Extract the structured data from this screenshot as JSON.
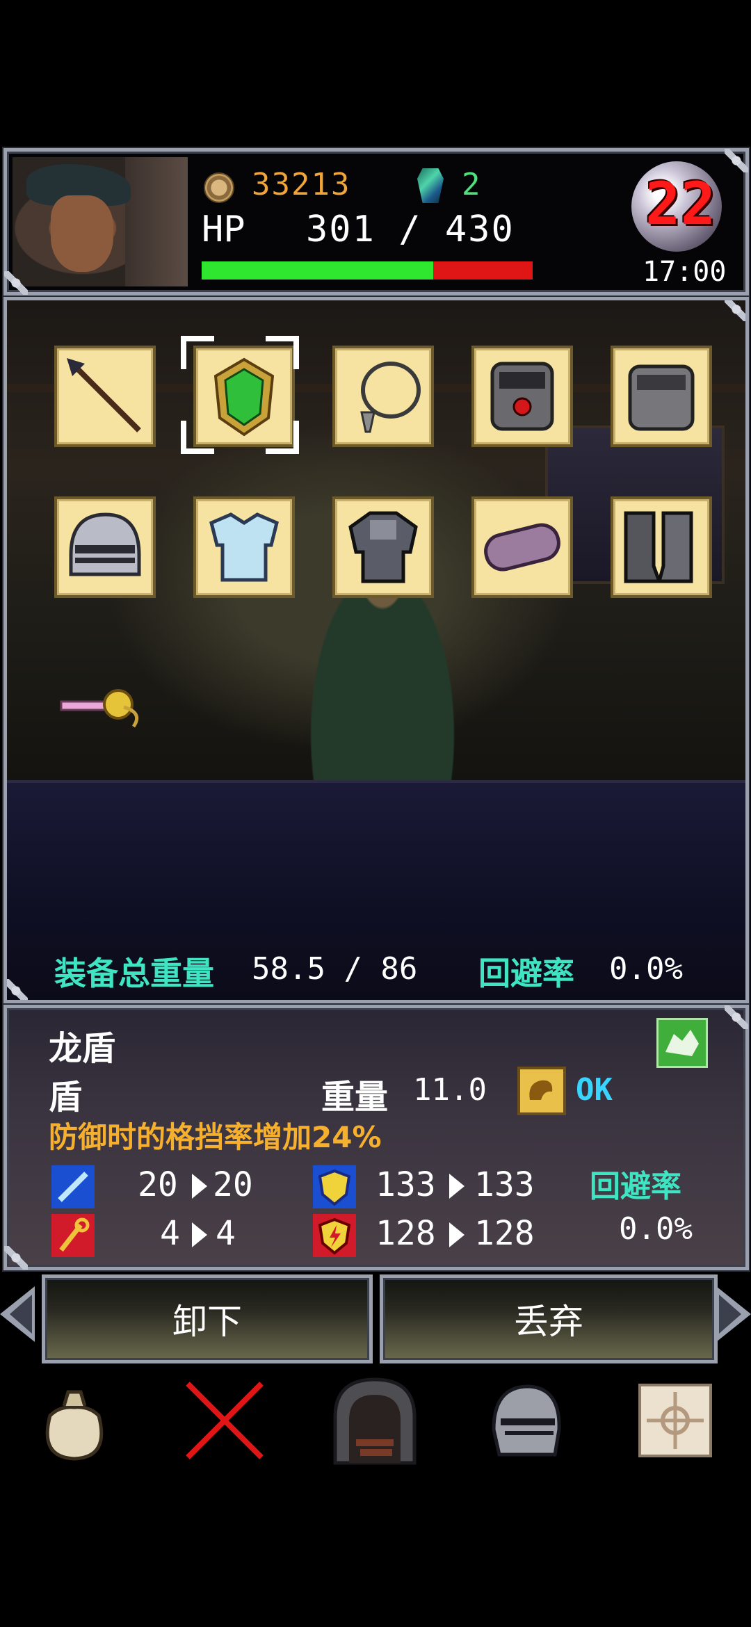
{
  "header": {
    "coins": "33213",
    "gems": "2",
    "hp_label": "HP",
    "hp_value": "301 / 430",
    "hp_fraction": 0.7,
    "day": "22",
    "time": "17:00"
  },
  "equipment": {
    "slots": [
      {
        "name": "spear"
      },
      {
        "name": "dragon-shield",
        "selected": true
      },
      {
        "name": "pendant"
      },
      {
        "name": "red-gem-bracer"
      },
      {
        "name": "iron-bracer"
      },
      {
        "name": "steel-helmet"
      },
      {
        "name": "blue-plate-armor"
      },
      {
        "name": "dark-armor"
      },
      {
        "name": "purple-gauntlet"
      },
      {
        "name": "iron-boots"
      },
      {
        "name": "rapier"
      }
    ],
    "weight_label": "装备总重量",
    "weight_value": "58.5 / 86",
    "evade_label": "回避率",
    "evade_value": "0.0%"
  },
  "detail": {
    "name": "龙盾",
    "type": "盾",
    "weight_label": "重量",
    "weight_value": "11.0",
    "ok_label": "OK",
    "description": "防御时的格挡率增加24%",
    "stats": {
      "attack_from": "20",
      "attack_to": "20",
      "defense_from": "133",
      "defense_to": "133",
      "magic_from": "4",
      "magic_to": "4",
      "mdef_from": "128",
      "mdef_to": "128"
    },
    "evade_label": "回避率",
    "evade_value": "0.0%"
  },
  "actions": {
    "unequip": "卸下",
    "discard": "丢弃"
  },
  "nav": [
    "bag-icon",
    "close-icon",
    "dungeon-door-icon",
    "knight-helmet-icon",
    "map-icon"
  ],
  "colors": {
    "accent_teal": "#3fe5c2",
    "coin_orange": "#f0a43a",
    "hp_green": "#2ee72e",
    "hp_red": "#e01515",
    "desc_orange": "#f7b02d",
    "ok_blue": "#39d5ff"
  }
}
